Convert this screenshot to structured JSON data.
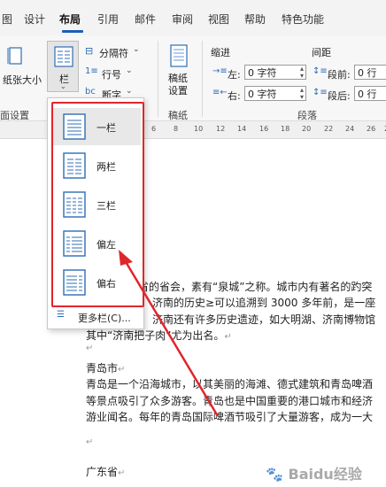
{
  "menu": {
    "tabs": [
      "图",
      "设计",
      "布局",
      "引用",
      "邮件",
      "审阅",
      "视图",
      "帮助",
      "特色功能"
    ],
    "active": "布局"
  },
  "ribbon": {
    "paper_size_label": "纸张大小",
    "columns_label": "栏",
    "breaks_label": "分隔符",
    "line_numbers_label": "行号",
    "hyphenation_label": "断字",
    "manuscript_label_line1": "稿纸",
    "manuscript_label_line2": "设置",
    "page_setup_group": "面设置",
    "manuscript_group": "稿纸",
    "paragraph_group": "段落",
    "indent_header": "缩进",
    "spacing_header": "间距",
    "indent_left_label": "左:",
    "indent_left_value": "0 字符",
    "indent_right_label": "右:",
    "indent_right_value": "0 字符",
    "space_before_label": "段前:",
    "space_before_value": "0 行",
    "space_after_label": "段后:",
    "space_after_value": "0 行"
  },
  "ruler": {
    "numbers": [
      "6",
      "8",
      "10",
      "12",
      "14",
      "16",
      "18",
      "20",
      "22",
      "24",
      "26",
      "28"
    ]
  },
  "columns_menu": {
    "items": [
      {
        "label": "一栏",
        "icon": "one-column-icon",
        "cols": 1
      },
      {
        "label": "两栏",
        "icon": "two-columns-icon",
        "cols": 2
      },
      {
        "label": "三栏",
        "icon": "three-columns-icon",
        "cols": 3
      },
      {
        "label": "偏左",
        "icon": "left-column-icon",
        "cols": -1
      },
      {
        "label": "偏右",
        "icon": "right-column-icon",
        "cols": -2
      }
    ],
    "more_label": "更多栏(C)..."
  },
  "document": {
    "lines": [
      "省的省会，素有“泉城”之称。城市内有著名的趵突",
      "济南的历史≥可以追溯到 3000 多年前，是一座",
      "济南还有许多历史遗迹，如大明湖、济南博物馆",
      "其中“济南把子肉”尤为出名。"
    ],
    "qingdao_title": "青岛市",
    "qingdao_lines": [
      "青岛是一个沿海城市，以其美丽的海滩、德式建筑和青岛啤酒",
      "等景点吸引了众多游客。青岛也是中国重要的港口城市和经济",
      "游业闻名。每年的青岛国际啤酒节吸引了大量游客，成为一大"
    ],
    "guangdong_title": "广东省",
    "para_mark": "↵"
  },
  "watermark": "Baidu经验",
  "colors": {
    "accent": "#1a5fb4",
    "annotation": "#e0262b"
  }
}
